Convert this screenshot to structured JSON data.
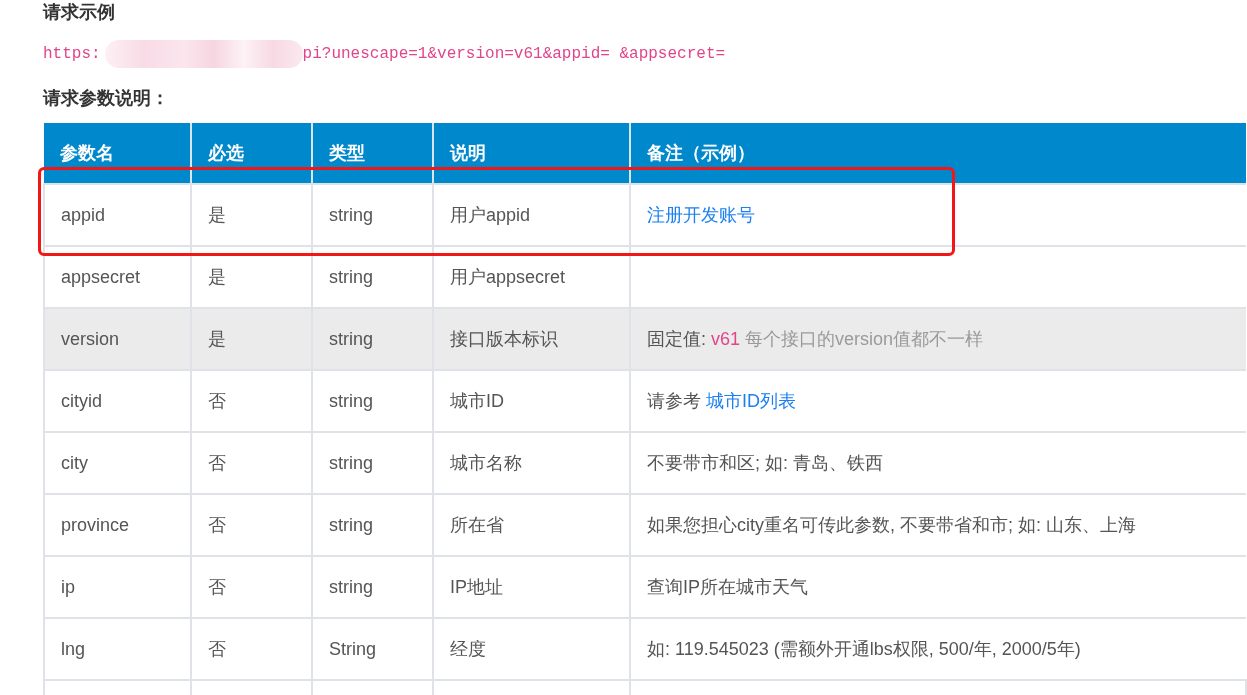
{
  "request_example": {
    "title": "请求示例",
    "url_start": "https:",
    "redacted": true,
    "url_end": "pi?unescape=1&version=v61&appid= &appsecret="
  },
  "params_section": {
    "title": "请求参数说明：",
    "table": {
      "columns": [
        "参数名",
        "必选",
        "类型",
        "说明",
        "备注（示例）"
      ],
      "rows": [
        {
          "name": "appid",
          "required": "是",
          "type": "string",
          "description": "用户appid",
          "remark": [
            {
              "kind": "link",
              "text": "注册开发账号"
            }
          ],
          "highlighted": false,
          "circled": true
        },
        {
          "name": "appsecret",
          "required": "是",
          "type": "string",
          "description": "用户appsecret",
          "highlighted": false,
          "circled": false
        },
        {
          "name": "version",
          "required": "是",
          "type": "string",
          "description": "接口版本标识",
          "remark": [
            {
              "kind": "text",
              "text": "固定值:"
            },
            {
              "kind": "code",
              "text": "v61"
            },
            {
              "kind": "note",
              "text": "每个接口的version值都不一样"
            }
          ],
          "highlighted": true,
          "circled": false
        },
        {
          "name": "cityid",
          "required": "否",
          "type": "string",
          "description": "城市ID",
          "remark": [
            {
              "kind": "text",
              "text": "请参考"
            },
            {
              "kind": "link",
              "text": "城市ID列表"
            }
          ],
          "highlighted": false,
          "circled": false
        },
        {
          "name": "city",
          "required": "否",
          "type": "string",
          "description": "城市名称",
          "remark": [
            {
              "kind": "text",
              "text": "不要带市和区; 如: 青岛、铁西"
            }
          ],
          "highlighted": false,
          "circled": false
        },
        {
          "name": "province",
          "required": "否",
          "type": "string",
          "description": "所在省",
          "remark": [
            {
              "kind": "text",
              "text": "如果您担心city重名可传此参数, 不要带省和市; 如: 山东、上海"
            }
          ],
          "highlighted": false,
          "circled": false
        },
        {
          "name": "ip",
          "required": "否",
          "type": "string",
          "description": "IP地址",
          "remark": [
            {
              "kind": "text",
              "text": "查询IP所在城市天气"
            }
          ],
          "highlighted": false,
          "circled": false
        },
        {
          "name": "lng",
          "required": "否",
          "type": "String",
          "description": "经度",
          "remark": [
            {
              "kind": "text",
              "text": "如: 119.545023 (需额外开通lbs权限, 500/年, 2000/5年)"
            }
          ],
          "highlighted": false,
          "circled": false
        }
      ]
    }
  }
}
